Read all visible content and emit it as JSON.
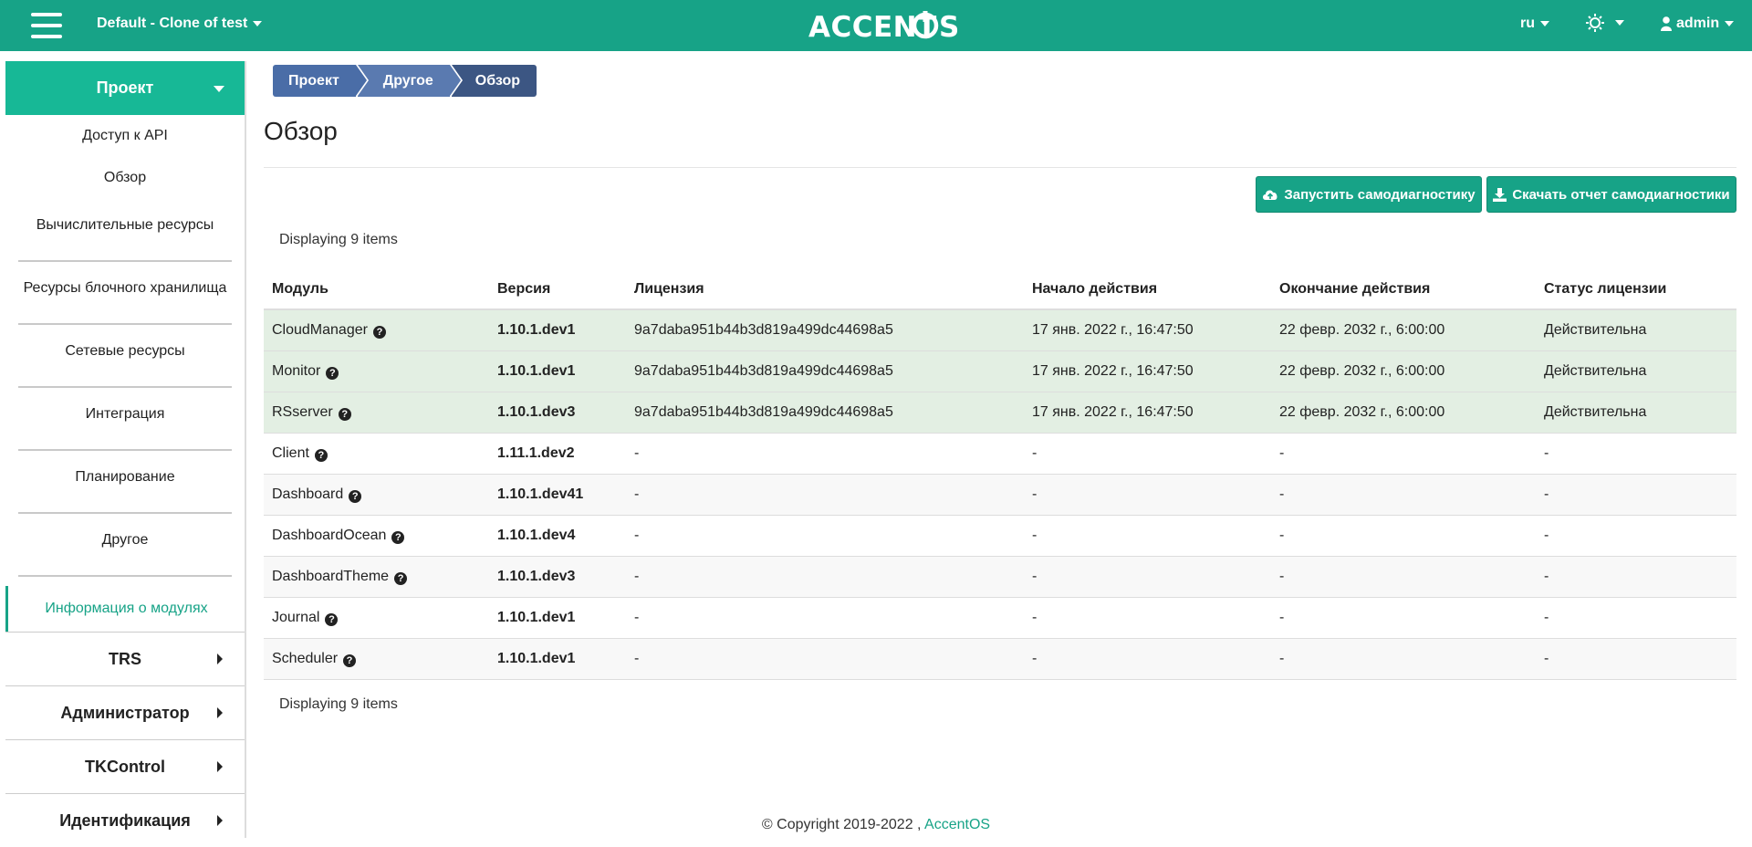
{
  "topbar": {
    "project_label": "Default - Clone of test",
    "lang": "ru",
    "user": "admin",
    "colors": {
      "brand": "#17a387",
      "sidebar_head": "#17b896"
    }
  },
  "breadcrumb": [
    "Проект",
    "Другое",
    "Обзор"
  ],
  "page_title": "Обзор",
  "buttons": {
    "run_diag": "Запустить самодиагностику",
    "download_report": "Скачать отчет самодиагностики"
  },
  "sidebar": {
    "header": "Проект",
    "plain_items": [
      "Доступ к API",
      "Обзор"
    ],
    "groups": [
      "Вычислительные ресурсы",
      "Ресурсы блочного хранилища",
      "Сетевые ресурсы",
      "Интеграция",
      "Планирование",
      "Другое"
    ],
    "active_item": "Информация о модулях",
    "sections": [
      "TRS",
      "Администратор",
      "TKControl",
      "Идентификация"
    ]
  },
  "table": {
    "count_top": "Displaying 9 items",
    "count_bottom": "Displaying 9 items",
    "columns": [
      "Модуль",
      "Версия",
      "Лицензия",
      "Начало действия",
      "Окончание действия",
      "Статус лицензии"
    ],
    "rows": [
      {
        "module": "CloudManager",
        "version": "1.10.1.dev1",
        "license": "9a7daba951b44b3d819a499dc44698a5",
        "start": "17 янв. 2022 г., 16:47:50",
        "end": "22 февр. 2032 г., 6:00:00",
        "status": "Действительна"
      },
      {
        "module": "Monitor",
        "version": "1.10.1.dev1",
        "license": "9a7daba951b44b3d819a499dc44698a5",
        "start": "17 янв. 2022 г., 16:47:50",
        "end": "22 февр. 2032 г., 6:00:00",
        "status": "Действительна"
      },
      {
        "module": "RSserver",
        "version": "1.10.1.dev3",
        "license": "9a7daba951b44b3d819a499dc44698a5",
        "start": "17 янв. 2022 г., 16:47:50",
        "end": "22 февр. 2032 г., 6:00:00",
        "status": "Действительна"
      },
      {
        "module": "Client",
        "version": "1.11.1.dev2",
        "license": "-",
        "start": "-",
        "end": "-",
        "status": "-"
      },
      {
        "module": "Dashboard",
        "version": "1.10.1.dev41",
        "license": "-",
        "start": "-",
        "end": "-",
        "status": "-"
      },
      {
        "module": "DashboardOcean",
        "version": "1.10.1.dev4",
        "license": "-",
        "start": "-",
        "end": "-",
        "status": "-"
      },
      {
        "module": "DashboardTheme",
        "version": "1.10.1.dev3",
        "license": "-",
        "start": "-",
        "end": "-",
        "status": "-"
      },
      {
        "module": "Journal",
        "version": "1.10.1.dev1",
        "license": "-",
        "start": "-",
        "end": "-",
        "status": "-"
      },
      {
        "module": "Scheduler",
        "version": "1.10.1.dev1",
        "license": "-",
        "start": "-",
        "end": "-",
        "status": "-"
      }
    ]
  },
  "footer": {
    "text": "© Copyright 2019-2022 ,",
    "link": "AccentOS"
  }
}
